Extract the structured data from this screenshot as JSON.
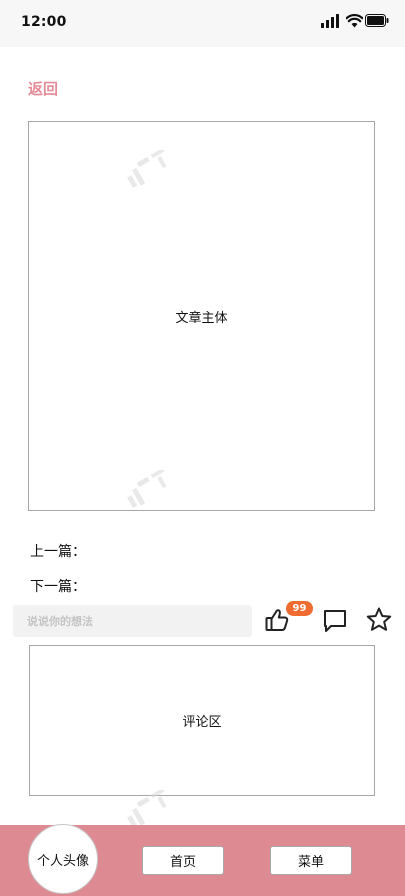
{
  "status_bar": {
    "time": "12:00"
  },
  "header": {
    "back_label": "返回"
  },
  "article": {
    "placeholder": "文章主体"
  },
  "navigation": {
    "prev_label": "上一篇：",
    "next_label": "下一篇："
  },
  "comment_bar": {
    "input_placeholder": "说说你的想法",
    "like_count": "99",
    "icons": [
      "thumbs-up-icon",
      "comment-icon",
      "star-icon"
    ]
  },
  "comments": {
    "placeholder": "评论区"
  },
  "bottom_bar": {
    "avatar_label": "个人头像",
    "home_label": "首页",
    "menu_label": "菜单"
  },
  "colors": {
    "accent": "#de8a92",
    "back_text": "#e48c97",
    "badge": "#ef6b2f"
  }
}
